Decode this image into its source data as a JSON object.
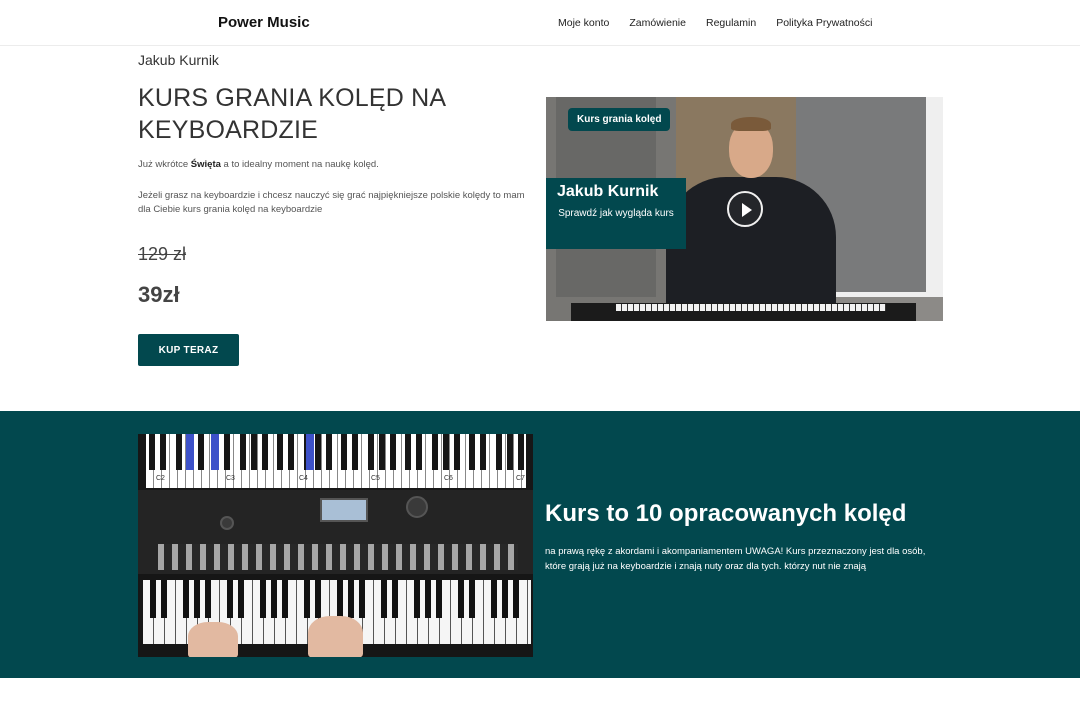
{
  "header": {
    "logo": "Power Music",
    "nav": [
      "Moje konto",
      "Zamówienie",
      "Regulamin",
      "Polityka Prywatności"
    ]
  },
  "hero": {
    "author": "Jakub Kurnik",
    "title": "KURS GRANIA KOLĘD NA KEYBOARDZIE",
    "intro_before": "Już wkrótce ",
    "intro_bold": "Święta",
    "intro_after": " a to idealny moment na naukę kolęd.",
    "description": "Jeżeli grasz na keyboardzie i chcesz nauczyć się grać najpiękniejsze polskie kolędy to mam dla Ciebie kurs grania kolęd na keyboardzie",
    "old_price": "129 zł",
    "new_price": "39zł",
    "buy_label": "KUP TERAZ"
  },
  "video": {
    "tag": "Kurs grania kolęd",
    "name": "Jakub Kurnik",
    "subtitle": "Sprawdź jak wygląda kurs"
  },
  "course": {
    "title": "Kurs to 10 opracowanych kolęd",
    "text": "na prawą rękę z akordami i akompaniamentem UWAGA! Kurs przeznaczony jest dla osób, które grają już na keyboardzie i znają nuty oraz dla tych. którzy nut nie znają",
    "key_labels": [
      "C2",
      "C3",
      "C4",
      "C5",
      "C6",
      "C7"
    ]
  },
  "colors": {
    "accent": "#02484e",
    "text": "#333333"
  }
}
